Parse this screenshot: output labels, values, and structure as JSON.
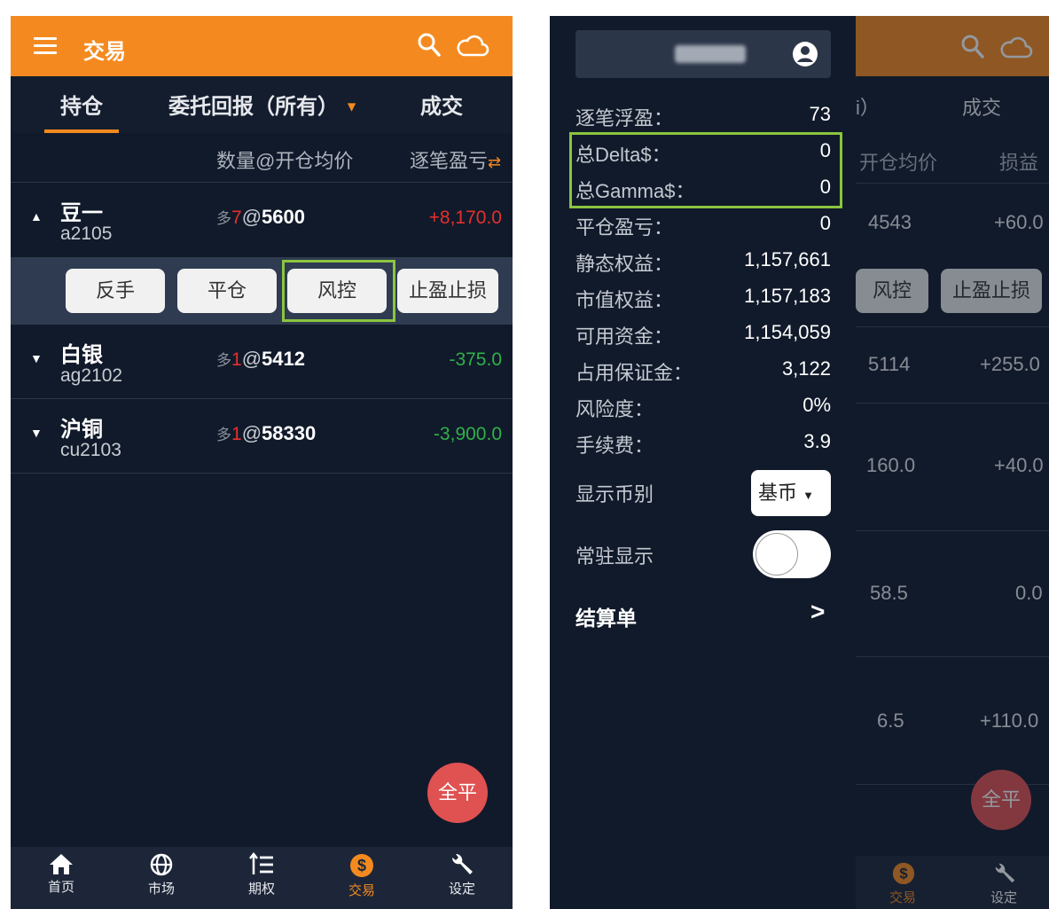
{
  "left": {
    "header": {
      "title": "交易"
    },
    "tabs": [
      {
        "label": "持仓"
      },
      {
        "label": "委托回报（所有）"
      },
      {
        "label": "成交"
      }
    ],
    "columns": {
      "qty_price": "数量@开仓均价",
      "pnl": "逐笔盈亏"
    },
    "rows": [
      {
        "name": "豆一",
        "code": "a2105",
        "dir": "多",
        "qty": "7",
        "at": "@",
        "price": "5600",
        "pnl": "+8,170.0",
        "caret": "▲"
      },
      {
        "name": "白银",
        "code": "ag2102",
        "dir": "多",
        "qty": "1",
        "at": "@",
        "price": "5412",
        "pnl": "-375.0",
        "caret": "▼"
      },
      {
        "name": "沪铜",
        "code": "cu2103",
        "dir": "多",
        "qty": "1",
        "at": "@",
        "price": "58330",
        "pnl": "-3,900.0",
        "caret": "▼"
      }
    ],
    "actions": [
      "反手",
      "平仓",
      "风控",
      "止盈止损"
    ],
    "fab": "全平",
    "nav": [
      {
        "label": "首页",
        "icon": "home-icon"
      },
      {
        "label": "市场",
        "icon": "globe-icon"
      },
      {
        "label": "期权",
        "icon": "list-icon"
      },
      {
        "label": "交易",
        "icon": "dollar-icon"
      },
      {
        "label": "设定",
        "icon": "wrench-icon"
      }
    ]
  },
  "right": {
    "info": [
      {
        "k": "逐笔浮盈：",
        "v": "73"
      },
      {
        "k": "总Delta$：",
        "v": "0"
      },
      {
        "k": "总Gamma$：",
        "v": "0"
      },
      {
        "k": "平仓盈亏：",
        "v": "0"
      },
      {
        "k": "静态权益：",
        "v": "1,157,661"
      },
      {
        "k": "市值权益：",
        "v": "1,157,183"
      },
      {
        "k": "可用资金：",
        "v": "1,154,059"
      },
      {
        "k": "占用保证金：",
        "v": "3,122"
      },
      {
        "k": "风险度：",
        "v": "0%"
      },
      {
        "k": "手续费：",
        "v": "3.9"
      }
    ],
    "currency_label": "显示币别",
    "currency_value": "基币",
    "persist_label": "常驻显示",
    "statement_label": "结算单",
    "background": {
      "tab_partial": "i）",
      "tab_trade": "成交",
      "col1": "开仓均价",
      "col2": "损益",
      "rows": [
        {
          "a": "4543",
          "b": "+60.0"
        },
        {
          "a": "5114",
          "b": "+255.0"
        },
        {
          "a": "160.0",
          "b": "+40.0"
        },
        {
          "a": "58.5",
          "b": "0.0"
        },
        {
          "a": "6.5",
          "b": "+110.0"
        }
      ],
      "btn1": "风控",
      "btn2": "止盈止损",
      "fab": "全平",
      "nav1": "交易",
      "nav2": "设定"
    }
  },
  "colors": {
    "accent": "#f48a1f",
    "highlight": "#8bc53f",
    "down": "#2fb14a",
    "up": "#e5302d"
  }
}
